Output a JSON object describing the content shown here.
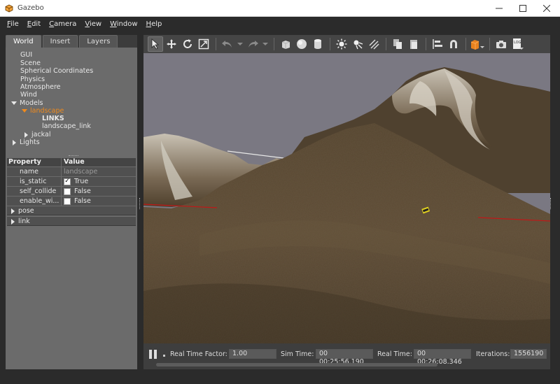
{
  "window": {
    "title": "Gazebo",
    "controls": [
      "minimize-icon",
      "maximize-icon",
      "close-icon"
    ]
  },
  "menubar": {
    "items": [
      {
        "label": "File",
        "accel": "F"
      },
      {
        "label": "Edit",
        "accel": "E"
      },
      {
        "label": "Camera",
        "accel": "C"
      },
      {
        "label": "View",
        "accel": "V"
      },
      {
        "label": "Window",
        "accel": "W"
      },
      {
        "label": "Help",
        "accel": "H"
      }
    ]
  },
  "left_panel": {
    "tabs": [
      {
        "label": "World",
        "active": true
      },
      {
        "label": "Insert",
        "active": false
      },
      {
        "label": "Layers",
        "active": false
      }
    ],
    "tree": {
      "gui": "GUI",
      "scene": "Scene",
      "spherical": "Spherical Coordinates",
      "physics": "Physics",
      "atmosphere": "Atmosphere",
      "wind": "Wind",
      "models": "Models",
      "landscape": "landscape",
      "links": "LINKS",
      "landscape_link": "landscape_link",
      "jackal": "jackal",
      "lights": "Lights"
    },
    "properties": {
      "header_property": "Property",
      "header_value": "Value",
      "name_label": "name",
      "name_value": "landscape",
      "is_static_label": "is_static",
      "is_static_value": "True",
      "self_collide_label": "self_collide",
      "self_collide_value": "False",
      "enable_wind_label": "enable_wi...",
      "enable_wind_value": "False",
      "pose_label": "pose",
      "link_label": "link"
    }
  },
  "toolbar": {
    "tools": [
      "select-icon",
      "translate-icon",
      "rotate-icon",
      "scale-icon",
      "undo-icon",
      "redo-icon",
      "box-icon",
      "sphere-icon",
      "cylinder-icon",
      "point-light-icon",
      "spot-light-icon",
      "directional-light-icon",
      "copy-icon",
      "paste-icon",
      "align-icon",
      "snap-icon",
      "view-angle-icon",
      "screenshot-icon",
      "log-icon"
    ]
  },
  "bottom_bar": {
    "rtf_label": "Real Time Factor:",
    "rtf_value": "1.00",
    "sim_time_label": "Sim Time:",
    "sim_time_value": "00 00:25:56.190",
    "real_time_label": "Real Time:",
    "real_time_value": "00 00:26:08.346",
    "iterations_label": "Iterations:",
    "iterations_value": "1556190"
  },
  "colors": {
    "accent_selected": "#f08a1c",
    "panel_bg": "#6b6b6b",
    "toolbar_bg": "#454545",
    "sky": "#7a7882",
    "terrain": "#5a4a34"
  }
}
